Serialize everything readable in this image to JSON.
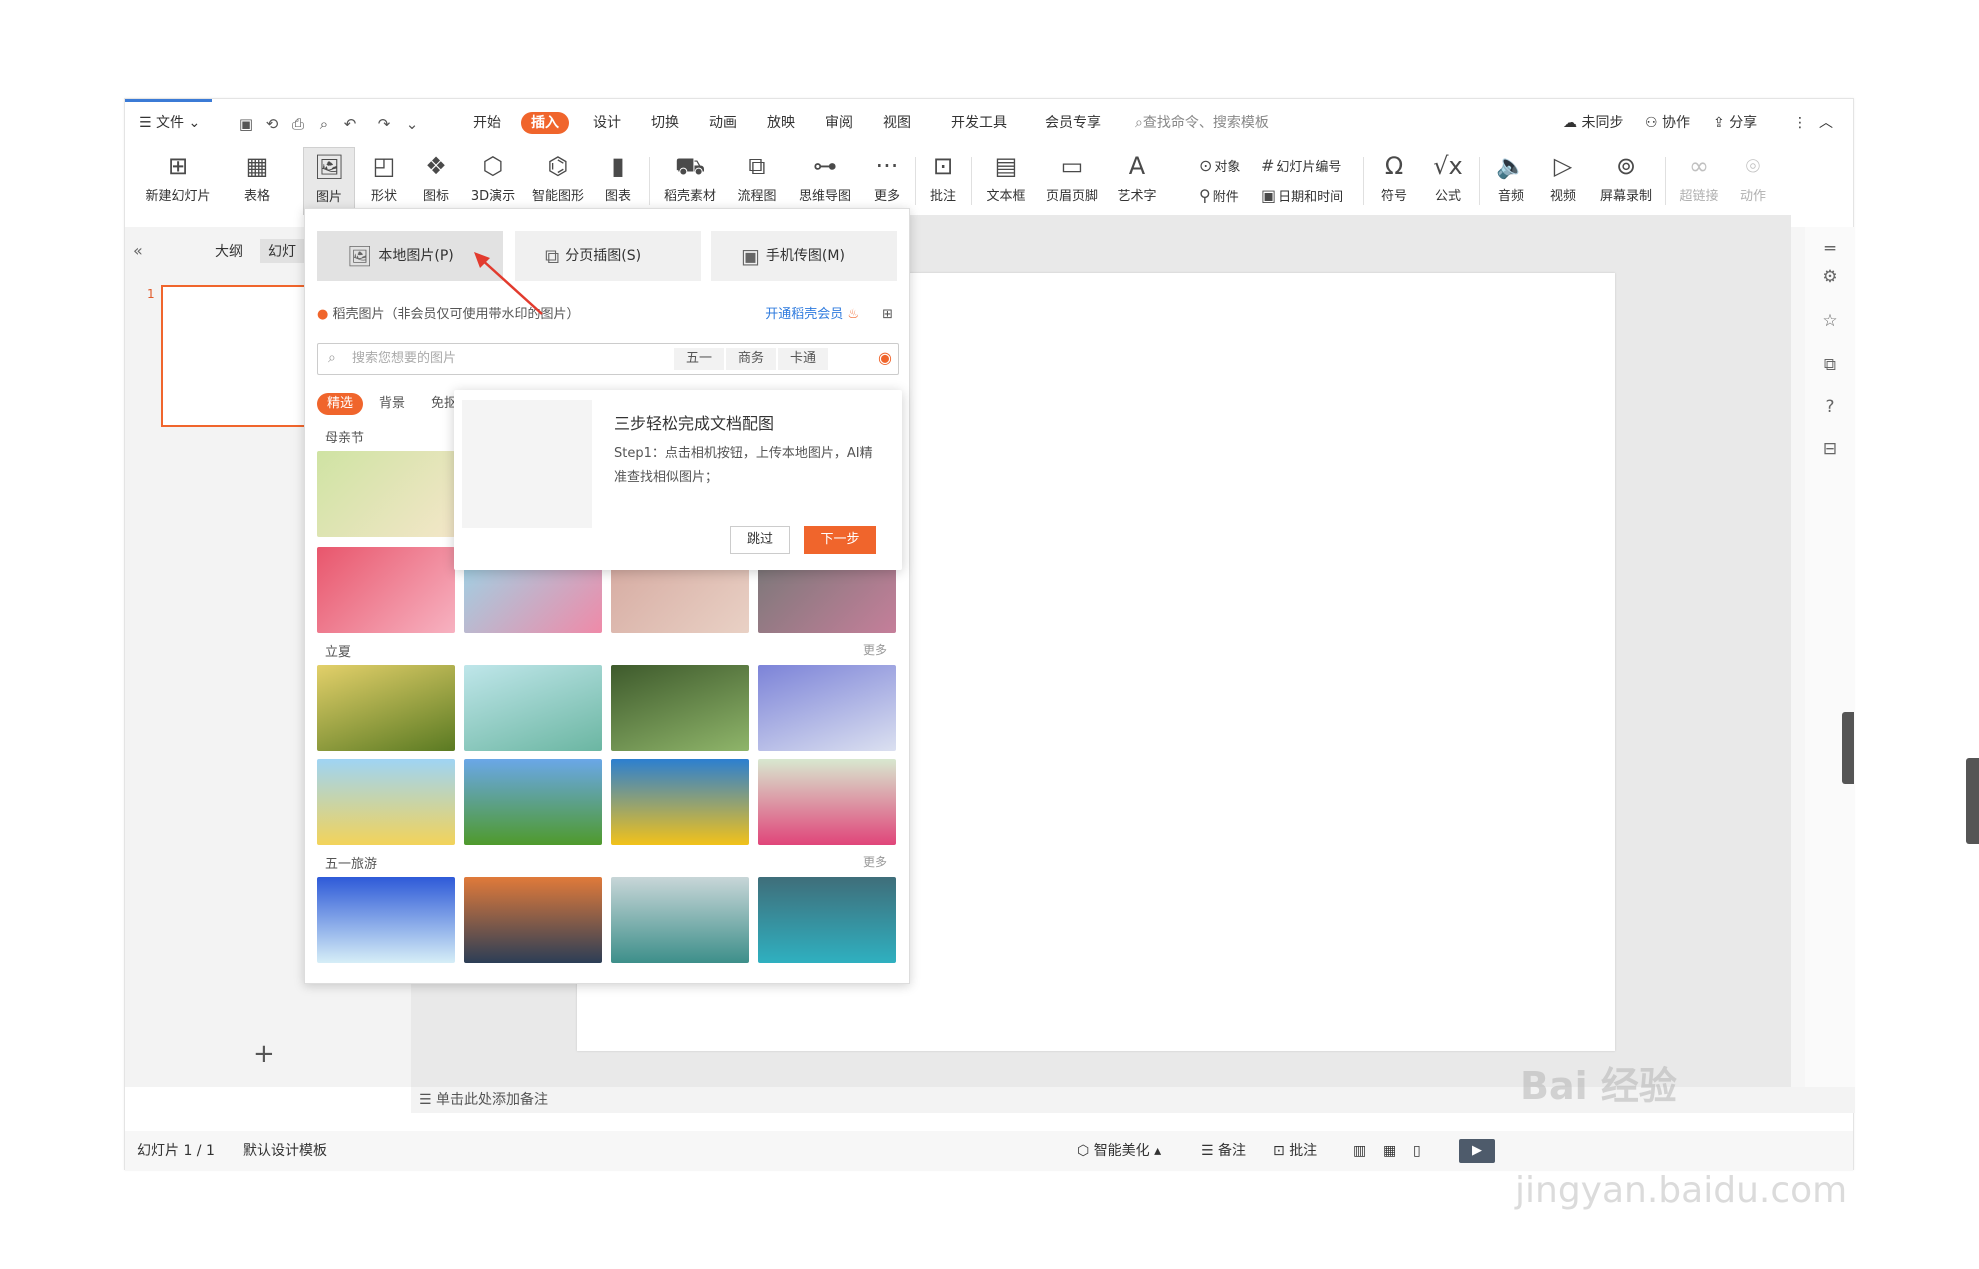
{
  "menu": {
    "file": "文件",
    "tabs": [
      "开始",
      "插入",
      "设计",
      "切换",
      "动画",
      "放映",
      "审阅",
      "视图",
      "开发工具",
      "会员专享"
    ],
    "active_tab": "插入",
    "search_placeholder": "查找命令、搜索模板",
    "sync": "未同步",
    "collab": "协作",
    "share": "分享"
  },
  "ribbon": {
    "new_slide": "新建幻灯片",
    "table": "表格",
    "picture": "图片",
    "shape": "形状",
    "icon": "图标",
    "demo3d": "3D演示",
    "smart": "智能图形",
    "chart": "图表",
    "docer": "稻壳素材",
    "flow": "流程图",
    "mind": "思维导图",
    "more": "更多",
    "comment": "批注",
    "textbox": "文本框",
    "header": "页眉页脚",
    "arttext": "艺术字",
    "object": "对象",
    "slide_no": "幻灯片编号",
    "attach": "附件",
    "datetime": "日期和时间",
    "symbol": "符号",
    "formula": "公式",
    "audio": "音频",
    "video": "视频",
    "screenrec": "屏幕录制",
    "hyperlink": "超链接",
    "action": "动作"
  },
  "left": {
    "tab_outline": "大纲",
    "tab_slides": "幻灯",
    "slide_number": "1"
  },
  "notes": "单击此处添加备注",
  "status": {
    "slide": "幻灯片 1 / 1",
    "template": "默认设计模板",
    "beautify": "智能美化",
    "notes": "备注",
    "comments": "批注"
  },
  "dropdown": {
    "btn_local": "本地图片(P)",
    "btn_page": "分页插图(S)",
    "btn_phone": "手机传图(M)",
    "vip_text": "稻壳图片（非会员仅可使用带水印的图片）",
    "vip_link": "开通稻壳会员",
    "search_placeholder": "搜索您想要的图片",
    "chips": [
      "五一",
      "商务",
      "卡通"
    ],
    "categories": [
      "精选",
      "背景",
      "免抠"
    ],
    "sections": [
      {
        "title": "母亲节",
        "more": ""
      },
      {
        "title": "立夏",
        "more": "更多"
      },
      {
        "title": "五一旅游",
        "more": "更多"
      }
    ]
  },
  "popup": {
    "title": "三步轻松完成文档配图",
    "text": "Step1：点击相机按钮，上传本地图片，AI精准查找相似图片；",
    "skip": "跳过",
    "next": "下一步"
  },
  "watermark": {
    "line1": "Bai 经验",
    "line2": "jingyan.baidu.com"
  }
}
